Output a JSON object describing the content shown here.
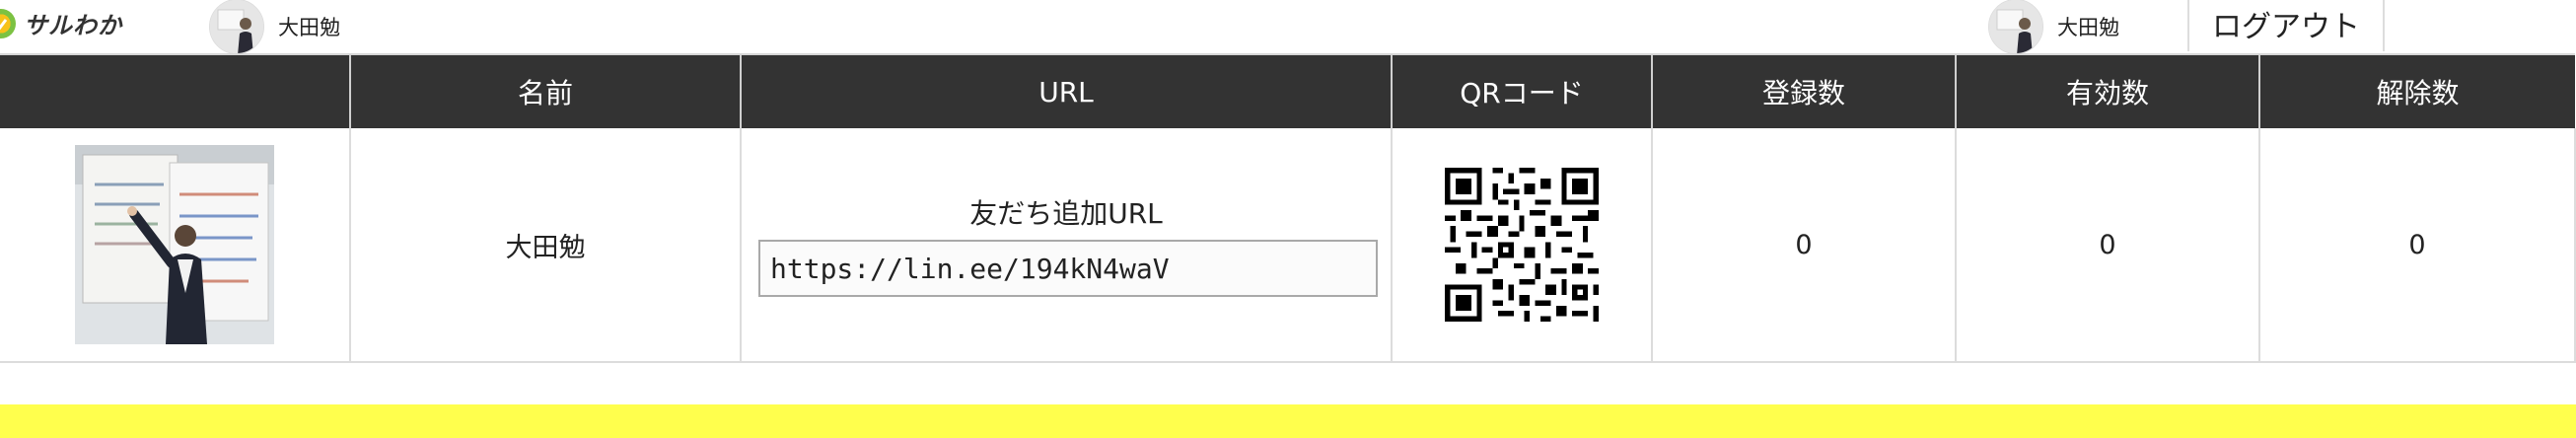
{
  "header": {
    "logo_text": "サルわか",
    "user_name": "大田勉",
    "logout_label": "ログアウト"
  },
  "table": {
    "headers": [
      "",
      "名前",
      "URL",
      "QRコード",
      "登録数",
      "有効数",
      "解除数"
    ],
    "row": {
      "name": "大田勉",
      "url_caption": "友だち追加URL",
      "url_value": "https://lin.ee/194kN4waV",
      "registered": "0",
      "active": "0",
      "removed": "0"
    }
  },
  "icons": {
    "logo": "saruwaka-logo-icon",
    "avatar": "user-avatar-icon",
    "qr": "qr-code-icon"
  },
  "colors": {
    "header_bg": "#333333",
    "accent_strip": "#ffff4d"
  }
}
